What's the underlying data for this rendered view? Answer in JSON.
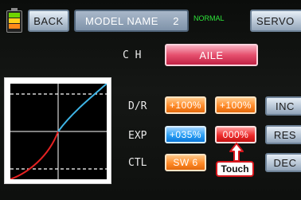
{
  "header": {
    "back_label": "BACK",
    "model_name_label": "MODEL NAME",
    "model_number": "2",
    "mode_label": "NORMAL",
    "servo_label": "SERVO"
  },
  "labels": {
    "ch": "C H",
    "dr": "D/R",
    "exp": "EXP",
    "ctl": "CTL"
  },
  "channel": {
    "value": "AILE"
  },
  "dual_rate": {
    "left": "+100%",
    "right": "+100%"
  },
  "expo": {
    "left": "+035%",
    "right": "000%"
  },
  "control": {
    "switch": "SW 6"
  },
  "actions": {
    "inc": "INC",
    "res": "RES",
    "dec": "DEC"
  },
  "annotation": {
    "touch_label": "Touch"
  },
  "colors": {
    "battery_green": "#6fd400",
    "battery_yellow": "#ffd11a",
    "battery_orange": "#ff8a1a",
    "mode_green": "#2ee63a",
    "channel_pink": "#e6506e",
    "value_orange": "#ff8a28",
    "value_blue": "#2aa0f5",
    "value_red": "#ee2b2b",
    "curve_red": "#e52222",
    "curve_blue": "#3fb6e8",
    "touch_red": "#d6161c"
  },
  "icons": {
    "battery": "battery-icon",
    "touch_arrow": "up-arrow-icon"
  }
}
